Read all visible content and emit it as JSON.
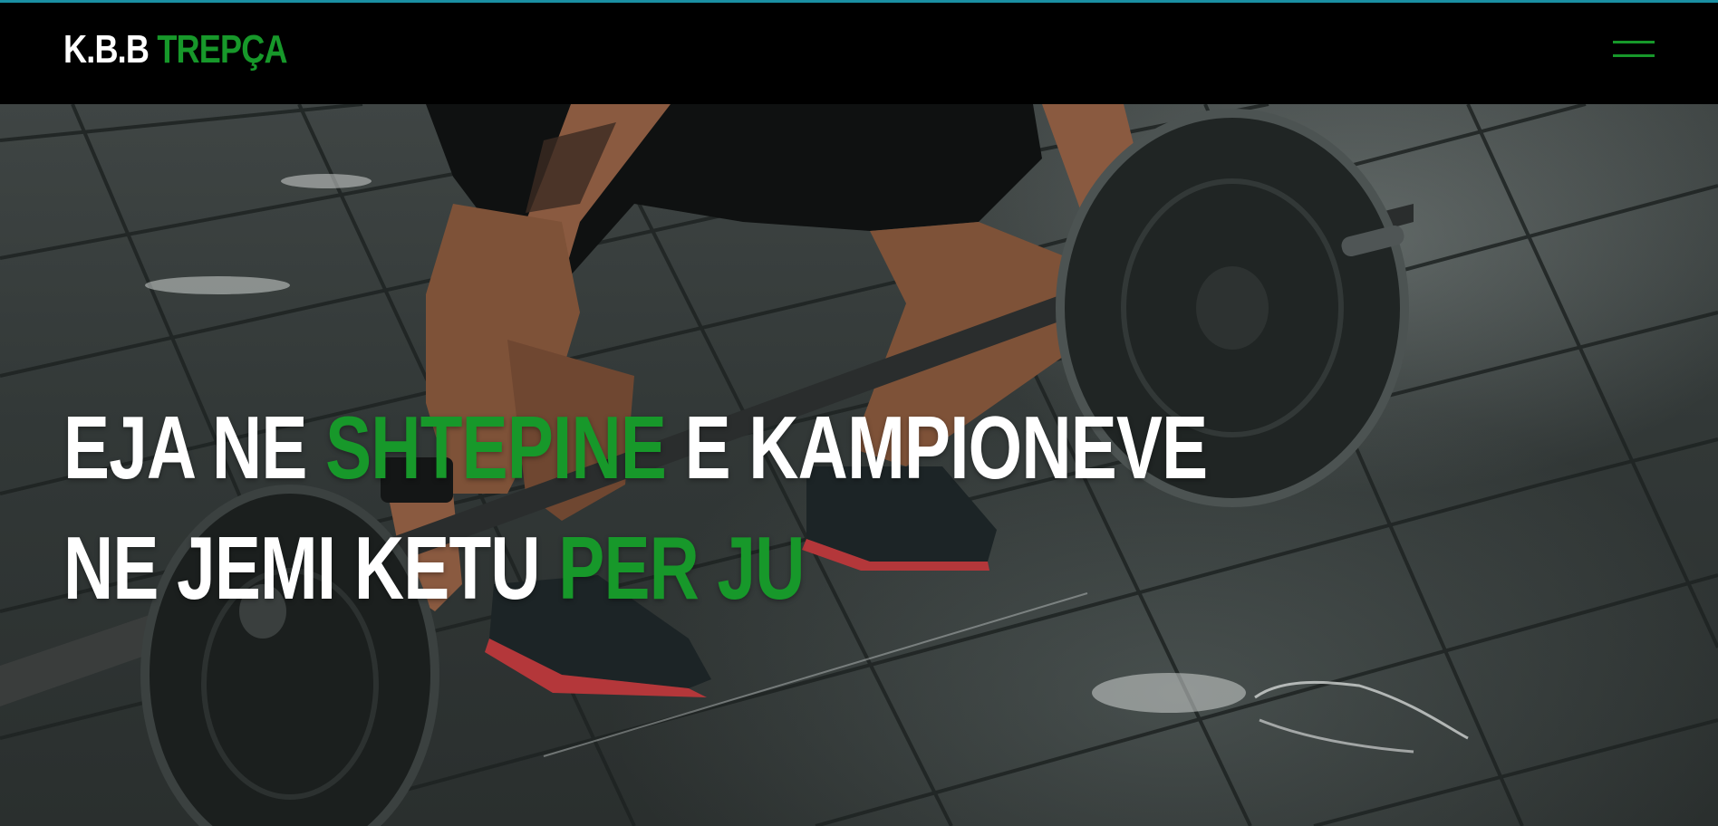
{
  "navbar": {
    "brand_part1": "K.B.B",
    "brand_part2": "TREPÇA",
    "menu_icon": "hamburger-menu-icon"
  },
  "hero": {
    "line1_part1": "EJA NE",
    "line1_part2": "SHTEPINE",
    "line1_part3": "E KAMPIONEVE",
    "line2_part1": "NE JEMI KETU",
    "line2_part2": "PER JU",
    "background_image": "weightlifter-deadlift-barbell-photo"
  },
  "colors": {
    "accent_green": "#17982a",
    "top_border": "#1a8fa3",
    "navbar_bg": "#000000",
    "text_white": "#ffffff"
  }
}
